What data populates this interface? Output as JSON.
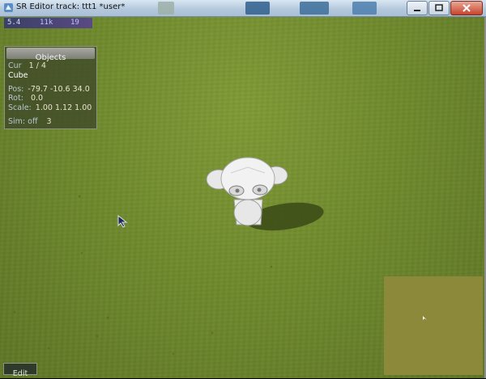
{
  "window": {
    "title": "SR Editor  track: ttt1  *user*",
    "buttons": {
      "minimize": "minimize-icon",
      "maximize": "maximize-icon",
      "close": "close-icon"
    }
  },
  "stats": {
    "fps": "5.4",
    "tris": "11k",
    "batches": "19"
  },
  "objects_panel": {
    "header": "Objects",
    "cur_label": "Cur",
    "cur_value": "1 / 4",
    "object_name": "Cube",
    "pos_label": "Pos:",
    "pos_value": "-79.7 -10.6 34.0",
    "rot_label": "Rot:",
    "rot_value": "0.0",
    "scale_label": "Scale:",
    "scale_value": "1.00 1.12 1.00",
    "sim_label": "Sim: off",
    "sim_value": "3"
  },
  "bottom_tab": {
    "label": "Edit"
  },
  "colors": {
    "terrain": "#718d2d",
    "minimap": "#8c8a3a",
    "panel": "#3a4228",
    "stats_bar": "#4a4476"
  }
}
